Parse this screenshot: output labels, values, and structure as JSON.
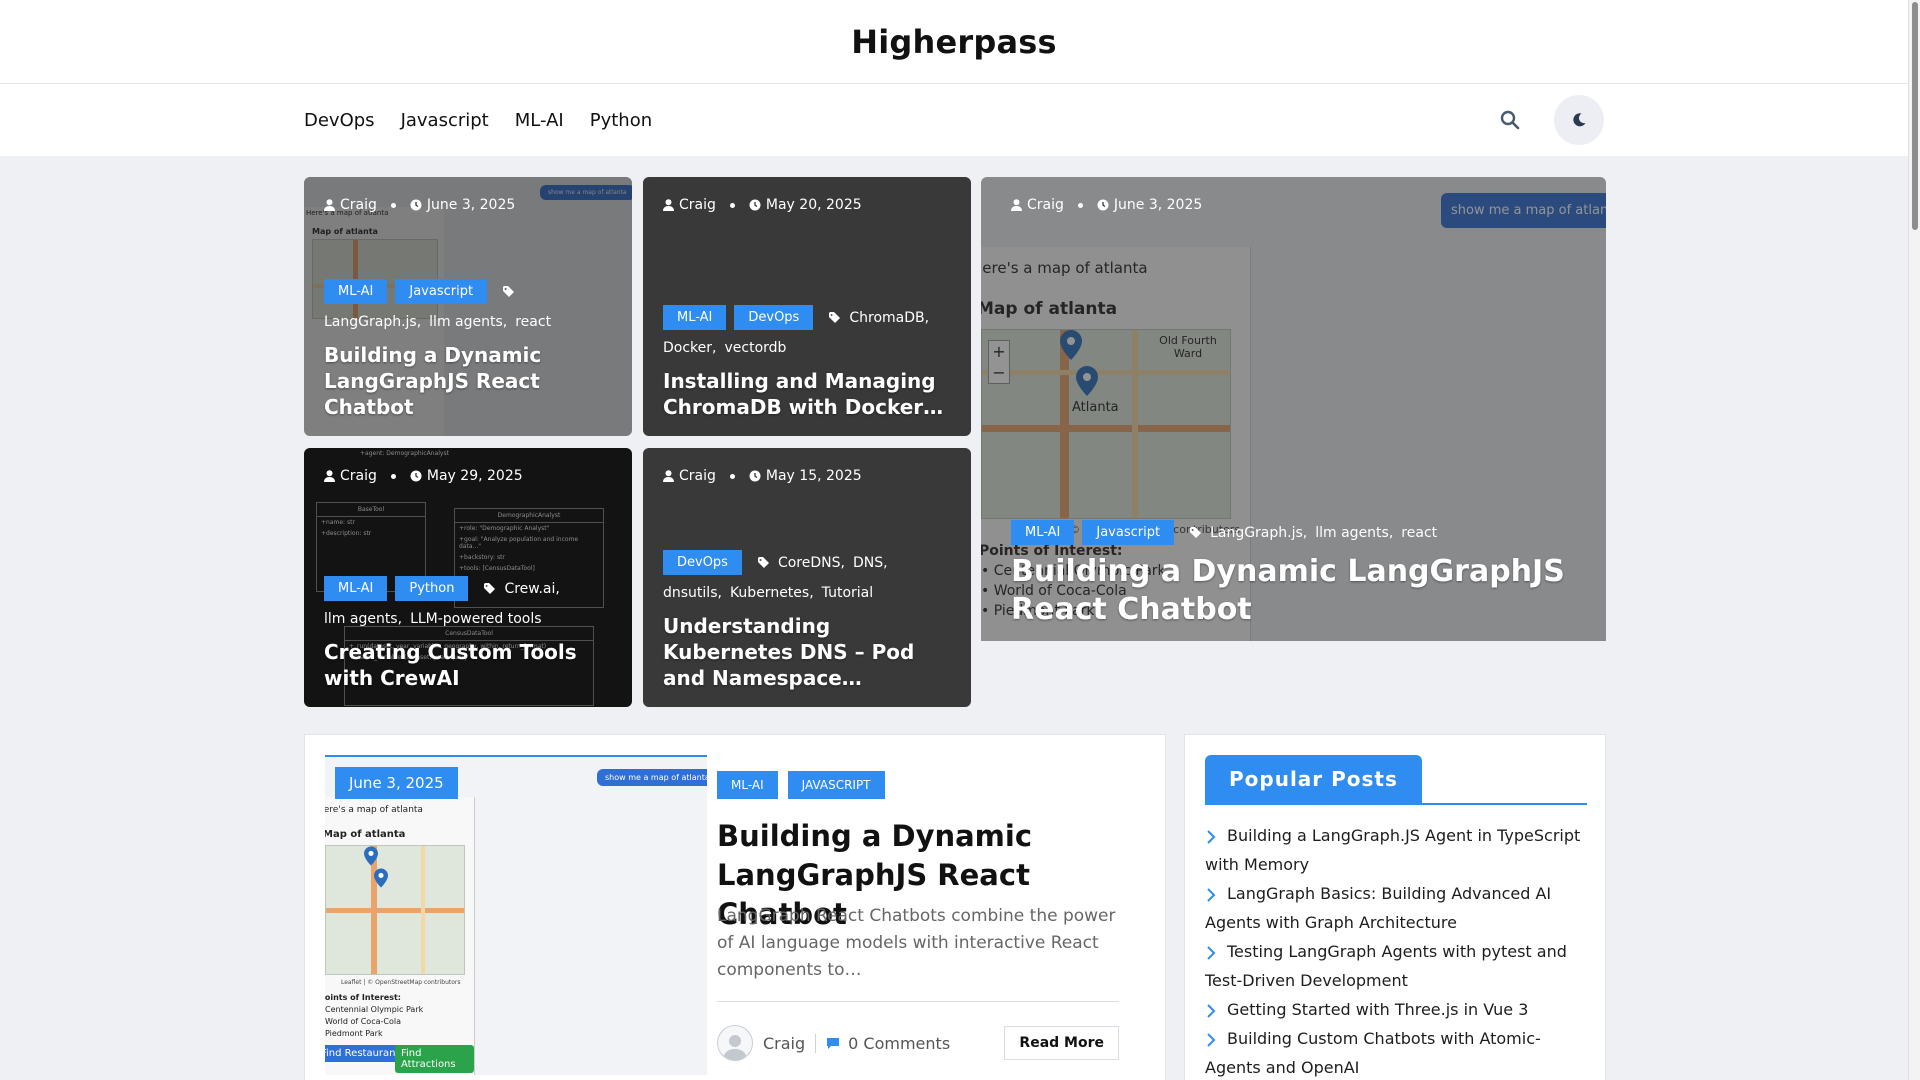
{
  "site": {
    "title": "Higherpass"
  },
  "nav": {
    "items": [
      "DevOps",
      "Javascript",
      "ML-AI",
      "Python"
    ],
    "search_icon": "search-icon",
    "dark_mode_icon": "moon-icon"
  },
  "featured": [
    {
      "author": "Craig",
      "date": "June 3, 2025",
      "categories": [
        "ML-AI",
        "Javascript"
      ],
      "tags": [
        "LangGraph.js",
        "llm agents",
        "react"
      ],
      "title": "Building a Dynamic LangGraphJS React Chatbot"
    },
    {
      "author": "Craig",
      "date": "May 20, 2025",
      "categories": [
        "ML-AI",
        "DevOps"
      ],
      "tags": [
        "ChromaDB",
        "Docker",
        "vectordb"
      ],
      "title": "Installing and Managing ChromaDB with Docker…"
    },
    {
      "author": "Craig",
      "date": "May 29, 2025",
      "categories": [
        "ML-AI",
        "Python"
      ],
      "tags": [
        "Crew.ai",
        "llm agents",
        "LLM-powered tools"
      ],
      "title": "Creating Custom Tools with CrewAI"
    },
    {
      "author": "Craig",
      "date": "May 15, 2025",
      "categories": [
        "DevOps"
      ],
      "tags": [
        "CoreDNS",
        "DNS",
        "dnsutils",
        "Kubernetes",
        "Tutorial"
      ],
      "title": "Understanding Kubernetes DNS – Pod and Namespace…"
    },
    {
      "author": "Craig",
      "date": "June 3, 2025",
      "categories": [
        "ML-AI",
        "Javascript"
      ],
      "tags": [
        "LangGraph.js",
        "llm agents",
        "react"
      ],
      "title": "Building a Dynamic LangGraphJS React Chatbot"
    }
  ],
  "mock_screens": {
    "show_map": "show me a map of atlanta",
    "heres_map": "Here's a map of atlanta",
    "map_title": "Map of atlanta",
    "map_area": "Old Fourth Ward",
    "map_city": "Atlanta",
    "attribution": "Leaflet | © OpenStreetMap contributors",
    "points_title": "Points of Interest:",
    "points": [
      "Centennial Olympic Park",
      "World of Coca-Cola",
      "Piedmont Park"
    ],
    "btn_restaurants": "Find Restaurants",
    "btn_attractions": "Find Attractions",
    "crew_nodes": [
      "BaseTool",
      "DemographicAnalyst",
      "CensusDataTool"
    ],
    "crew_lines": [
      "+name: str",
      "+description: str",
      "+role: \"Demographic Analyst\"",
      "+goal: \"Analyze population and income data...\"",
      "+backstory: str",
      "+tools: [CensusDataTool]",
      "+agent: DemographicAnalyst",
      "+_run(dataset, year, variables, geography, within, return_format)",
      "+search_variables(dataset, year, query"
    ]
  },
  "latest_post": {
    "date": "June 3, 2025",
    "categories": [
      "ML-AI",
      "JAVASCRIPT"
    ],
    "title": "Building a Dynamic LangGraphJS React Chatbot",
    "excerpt": "LangGraph React Chatbots combine the power of AI language models with interactive React components to…",
    "author": "Craig",
    "comments": "0 Comments",
    "read_more": "Read More"
  },
  "sidebar": {
    "title": "Popular Posts",
    "items": [
      "Building a LangGraph.JS Agent in TypeScript with Memory",
      "LangGraph Basics: Building Advanced AI Agents with Graph Architecture",
      "Testing LangGraph Agents with pytest and Test-Driven Development",
      "Getting Started with Three.js in Vue 3",
      "Building Custom Chatbots with Atomic-Agents and OpenAI"
    ]
  },
  "colors": {
    "accent": "#2f8cf0",
    "page_bg": "#eef0f4",
    "text": "#1d1d1d"
  }
}
